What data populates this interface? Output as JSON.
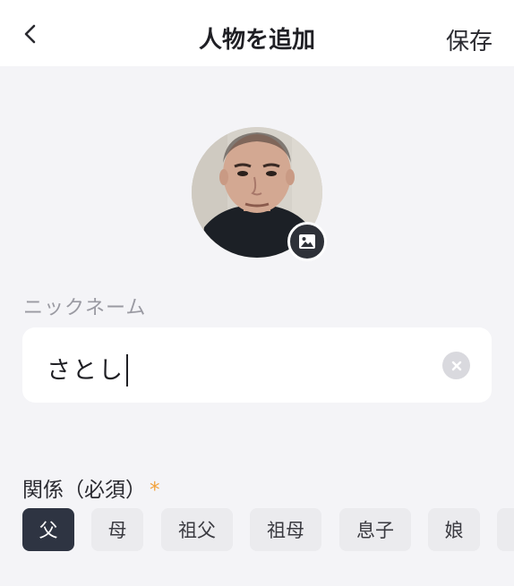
{
  "header": {
    "title": "人物を追加",
    "save_label": "保存",
    "back_icon": "chevron-left-icon"
  },
  "avatar": {
    "badge_icon": "image-icon"
  },
  "nickname": {
    "label": "ニックネーム",
    "value": "さとし",
    "clear_icon": "close-icon"
  },
  "relation": {
    "label": "関係（必須）",
    "required_mark": "*",
    "options": [
      "父",
      "母",
      "祖父",
      "祖母",
      "息子",
      "娘"
    ],
    "selected": "父"
  },
  "colors": {
    "background": "#f4f4f7",
    "selected_chip": "#2e3442",
    "required": "#f2a23c"
  }
}
